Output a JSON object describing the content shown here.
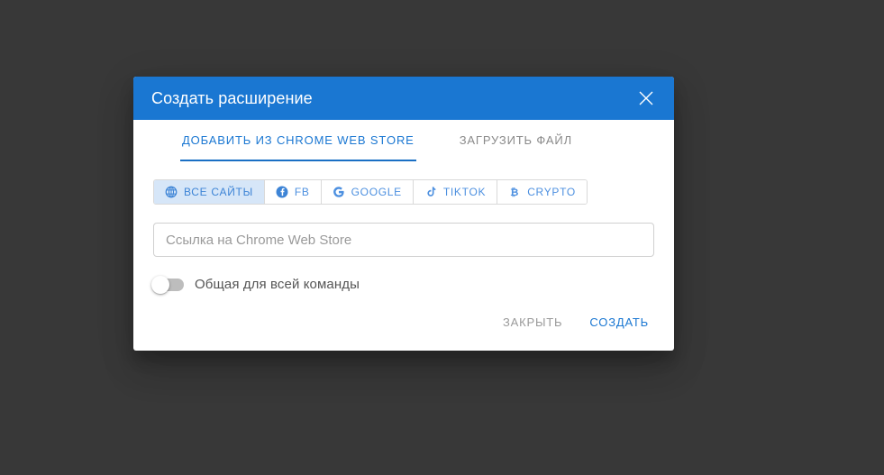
{
  "theme": {
    "page_background": "#383838",
    "accent": "#1a77d2",
    "header_background": "#1a77d2",
    "chip_active_background": "#d6e6f8",
    "chip_text": "#4d90e0",
    "muted_text": "#9a9a9a",
    "dialog_background": "#ffffff"
  },
  "dialog": {
    "title": "Создать расширение",
    "close_icon": "close-icon"
  },
  "tabs": [
    {
      "label": "ДОБАВИТЬ ИЗ CHROME WEB STORE",
      "active": true
    },
    {
      "label": "ЗАГРУЗИТЬ ФАЙЛ",
      "active": false
    }
  ],
  "filters": [
    {
      "label": "ВСЕ САЙТЫ",
      "icon": "globe-icon",
      "active": true
    },
    {
      "label": "FB",
      "icon": "facebook-icon",
      "active": false
    },
    {
      "label": "GOOGLE",
      "icon": "google-icon",
      "active": false
    },
    {
      "label": "TIKTOK",
      "icon": "tiktok-icon",
      "active": false
    },
    {
      "label": "CRYPTO",
      "icon": "bitcoin-icon",
      "active": false
    }
  ],
  "form": {
    "url_input": {
      "value": "",
      "placeholder": "Ссылка на Chrome Web Store"
    },
    "share_toggle": {
      "label": "Общая для всей команды",
      "checked": false
    }
  },
  "footer": {
    "close_label": "ЗАКРЫТЬ",
    "create_label": "СОЗДАТЬ"
  }
}
